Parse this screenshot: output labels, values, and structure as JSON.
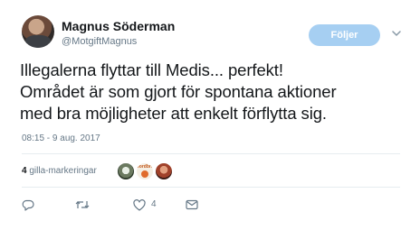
{
  "author": {
    "name": "Magnus Söderman",
    "handle": "@MotgiftMagnus"
  },
  "follow_button": {
    "label": "Följer"
  },
  "tweet": {
    "line1": "Illegalerna flyttar till Medis... perfekt!",
    "line2": "Området är som gjort för spontana aktioner",
    "line3": "med bra möjligheter att enkelt förflytta sig.",
    "timestamp": "08:15 - 9 aug. 2017"
  },
  "engagement": {
    "likes_count": "4",
    "likes_label": "gilla-markeringar",
    "liker_badge_text": "Jordbruk"
  },
  "actions": {
    "like_count": "4",
    "icons": [
      "reply-icon",
      "retweet-icon",
      "heart-icon",
      "message-icon"
    ]
  },
  "colors": {
    "follow_button_bg": "#a6cff2",
    "secondary_text": "#657786",
    "primary_text": "#14171a",
    "divider": "#e6ecf0"
  }
}
